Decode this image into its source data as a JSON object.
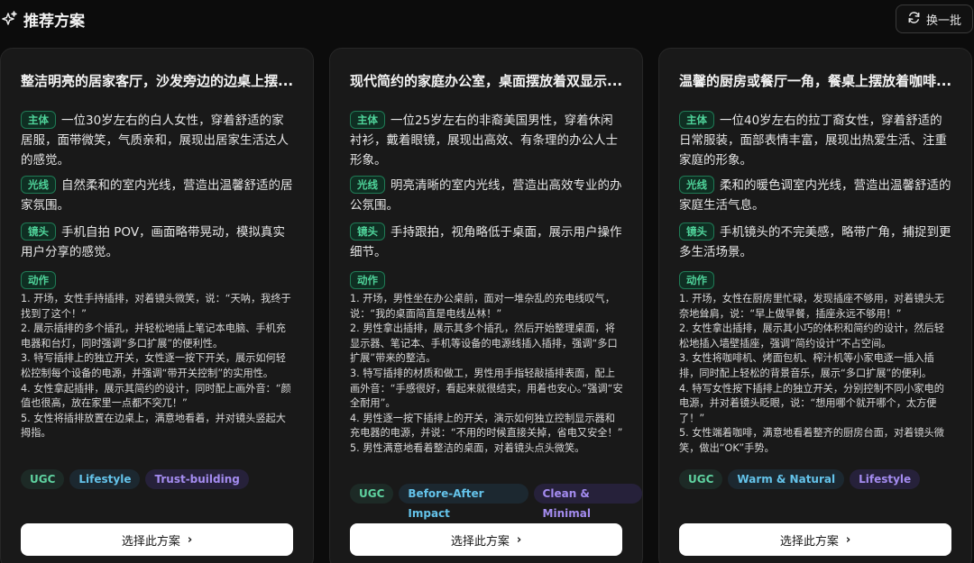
{
  "header": {
    "title": "推荐方案",
    "refresh_label": "换一批"
  },
  "labels": {
    "subject": "主体",
    "lighting": "光线",
    "camera": "镜头",
    "action": "动作"
  },
  "colors": {
    "accent_green": "#4fd39a",
    "chip_green": "#5fd3a0",
    "chip_blue": "#64c3ea",
    "chip_purple": "#a48cf0"
  },
  "cards": [
    {
      "title": "整洁明亮的居家客厅，沙发旁边的边桌上摆...",
      "subject": "一位30岁左右的白人女性，穿着舒适的家居服，面带微笑，气质亲和，展现出居家生活达人的感觉。",
      "lighting": "自然柔和的室内光线，营造出温馨舒适的居家氛围。",
      "camera": "手机自拍 POV，画面略带晃动，模拟真实用户分享的感觉。",
      "actions": [
        "1. 开场，女性手持插排，对着镜头微笑，说：“天呐，我终于找到了这个！”",
        "2. 展示插排的多个插孔，并轻松地插上笔记本电脑、手机充电器和台灯，同时强调“多口扩展”的便利性。",
        "3. 特写插排上的独立开关，女性逐一按下开关，展示如何轻松控制每个设备的电源，并强调“带开关控制”的实用性。",
        "4. 女性拿起插排，展示其简约的设计，同时配上画外音：“颜值也很高，放在家里一点都不突兀！”",
        "5. 女性将插排放置在边桌上，满意地看着，并对镜头竖起大拇指。"
      ],
      "chips": [
        "UGC",
        "Lifestyle",
        "Trust-building"
      ],
      "button_label": "选择此方案"
    },
    {
      "title": "现代简约的家庭办公室，桌面摆放着双显示...",
      "subject": "一位25岁左右的非裔美国男性，穿着休闲衬衫，戴着眼镜，展现出高效、有条理的办公人士形象。",
      "lighting": "明亮清晰的室内光线，营造出高效专业的办公氛围。",
      "camera": "手持跟拍，视角略低于桌面，展示用户操作细节。",
      "actions": [
        "1. 开场，男性坐在办公桌前，面对一堆杂乱的充电线叹气，说：“我的桌面简直是电线丛林！”",
        "2. 男性拿出插排，展示其多个插孔，然后开始整理桌面，将显示器、笔记本、手机等设备的电源线插入插排，强调“多口扩展”带来的整洁。",
        "3. 特写插排的材质和做工，男性用手指轻敲插排表面，配上画外音：“手感很好，看起来就很结实，用着也安心。”强调“安全耐用”。",
        "4. 男性逐一按下插排上的开关，演示如何独立控制显示器和充电器的电源，并说：“不用的时候直接关掉，省电又安全！”",
        "5. 男性满意地看着整洁的桌面，对着镜头点头微笑。"
      ],
      "chips": [
        "UGC",
        "Before-After Impact",
        "Clean & Minimal"
      ],
      "button_label": "选择此方案"
    },
    {
      "title": "温馨的厨房或餐厅一角，餐桌上摆放着咖啡...",
      "subject": "一位40岁左右的拉丁裔女性，穿着舒适的日常服装，面部表情丰富，展现出热爱生活、注重家庭的形象。",
      "lighting": "柔和的暖色调室内光线，营造出温馨舒适的家庭生活气息。",
      "camera": "手机镜头的不完美感，略带广角，捕捉到更多生活场景。",
      "actions": [
        "1. 开场，女性在厨房里忙碌，发现插座不够用，对着镜头无奈地耸肩，说：“早上做早餐，插座永远不够用！”",
        "2. 女性拿出插排，展示其小巧的体积和简约的设计，然后轻松地插入墙壁插座，强调“简约设计”不占空间。",
        "3. 女性将咖啡机、烤面包机、榨汁机等小家电逐一插入插排，同时配上轻松的背景音乐，展示“多口扩展”的便利。",
        "4. 特写女性按下插排上的独立开关，分别控制不同小家电的电源，并对着镜头眨眼，说：“想用哪个就开哪个，太方便了！”",
        "5. 女性端着咖啡，满意地看着整齐的厨房台面，对着镜头微笑，做出“OK”手势。"
      ],
      "chips": [
        "UGC",
        "Warm & Natural",
        "Lifestyle"
      ],
      "button_label": "选择此方案"
    }
  ]
}
